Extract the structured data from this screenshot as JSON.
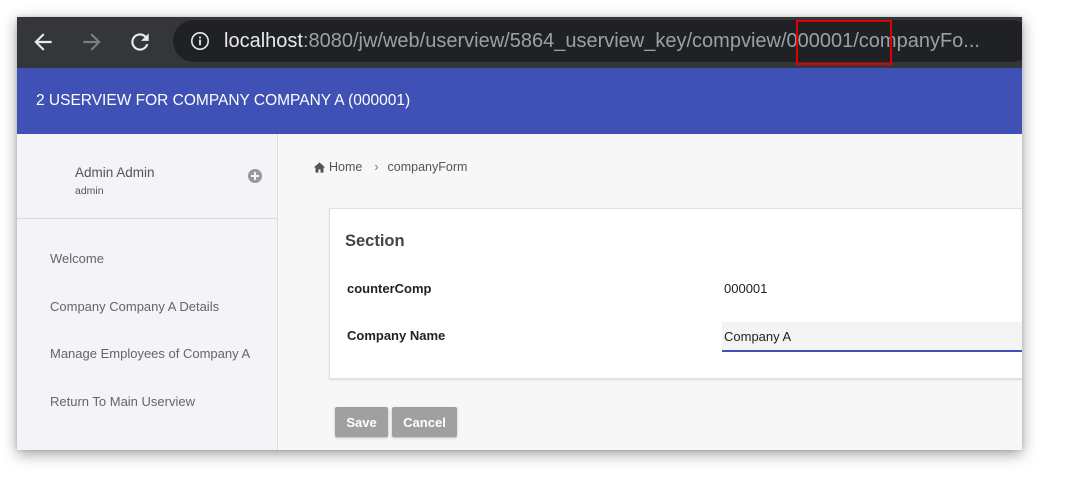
{
  "browser": {
    "url_host": "localhost",
    "url_path": ":8080/jw/web/userview/5864_userview_key/compview/000001/companyFo..."
  },
  "header": {
    "title": "2 USERVIEW FOR COMPANY COMPANY A (000001)",
    "color": "#3f51b5"
  },
  "sidebar": {
    "user": {
      "name": "Admin Admin",
      "login": "admin"
    },
    "items": [
      {
        "label": "Welcome"
      },
      {
        "label": "Company Company A Details"
      },
      {
        "label": "Manage Employees of Company A"
      },
      {
        "label": "Return To Main Userview"
      }
    ]
  },
  "breadcrumb": {
    "home": "Home",
    "current": "companyForm"
  },
  "form": {
    "section_title": "Section",
    "fields": [
      {
        "label": "counterComp",
        "value": "000001"
      },
      {
        "label": "Company Name",
        "value": "Company A"
      }
    ]
  },
  "buttons": {
    "save": "Save",
    "cancel": "Cancel"
  },
  "icons": {
    "back": "arrow-left-icon",
    "forward": "arrow-right-icon",
    "reload": "reload-icon",
    "info": "info-icon",
    "add": "plus-circle-icon",
    "home": "home-icon"
  }
}
